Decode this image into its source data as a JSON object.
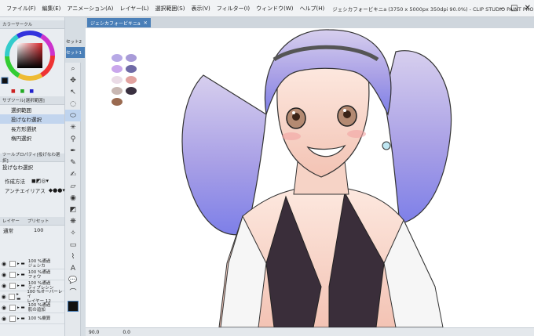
{
  "menu": [
    "ファイル(F)",
    "編集(E)",
    "アニメーション(A)",
    "レイヤー(L)",
    "選択範囲(S)",
    "表示(V)",
    "フィルター(I)",
    "ウィンドウ(W)",
    "ヘルプ(H)"
  ],
  "window_title": "ジェシカフォービキニa (3750 x 5000px 350dpi 90.0%) - CLIP STUDIO PAINT PRO",
  "doc_tab": "ジェシカフォービキニa",
  "color_panel": {
    "title": "カラーサークル"
  },
  "subtool": {
    "title": "サブツール[選択範囲]",
    "items": [
      "選択範囲",
      "投げなわ選択",
      "長方形選択",
      "楕円選択"
    ],
    "selected": "投げなわ選択"
  },
  "tool_property": {
    "title": "ツールプロパティ[投げなわ選択]",
    "tool_name": "投げなわ選択",
    "row1": "作成方法",
    "row2": "アンチエイリアス"
  },
  "layer_panel": {
    "tabs": [
      "レイヤー",
      "プリセット"
    ],
    "blend": "通常",
    "opacity": "100",
    "layers": [
      {
        "pct": "100 %通過",
        "name": "ジェシカ"
      },
      {
        "pct": "100 %通過",
        "name": "フォウ"
      },
      {
        "pct": "100 %通過",
        "name": "ティプレシン"
      },
      {
        "pct": "100 %オーバーレイ",
        "name": "レイヤー 12"
      },
      {
        "pct": "100 %通過",
        "name": "肌の追加"
      },
      {
        "pct": "100 %乗算",
        "name": ""
      }
    ]
  },
  "sets": [
    "セット2",
    "セット1"
  ],
  "status": {
    "zoom": "90.0",
    "angle": "0.0"
  },
  "colors": {
    "accent": "#4a7fb8",
    "hair": "#9a8fe0",
    "skin": "#f7d6c9"
  },
  "swatches": [
    "#b7a9e6",
    "#a89bd8",
    "#c9a6ec",
    "#6f6aa6",
    "#eadbe6",
    "#e2a3a0",
    "#c8b7b2",
    "#3a3040",
    "#9a6a50"
  ]
}
